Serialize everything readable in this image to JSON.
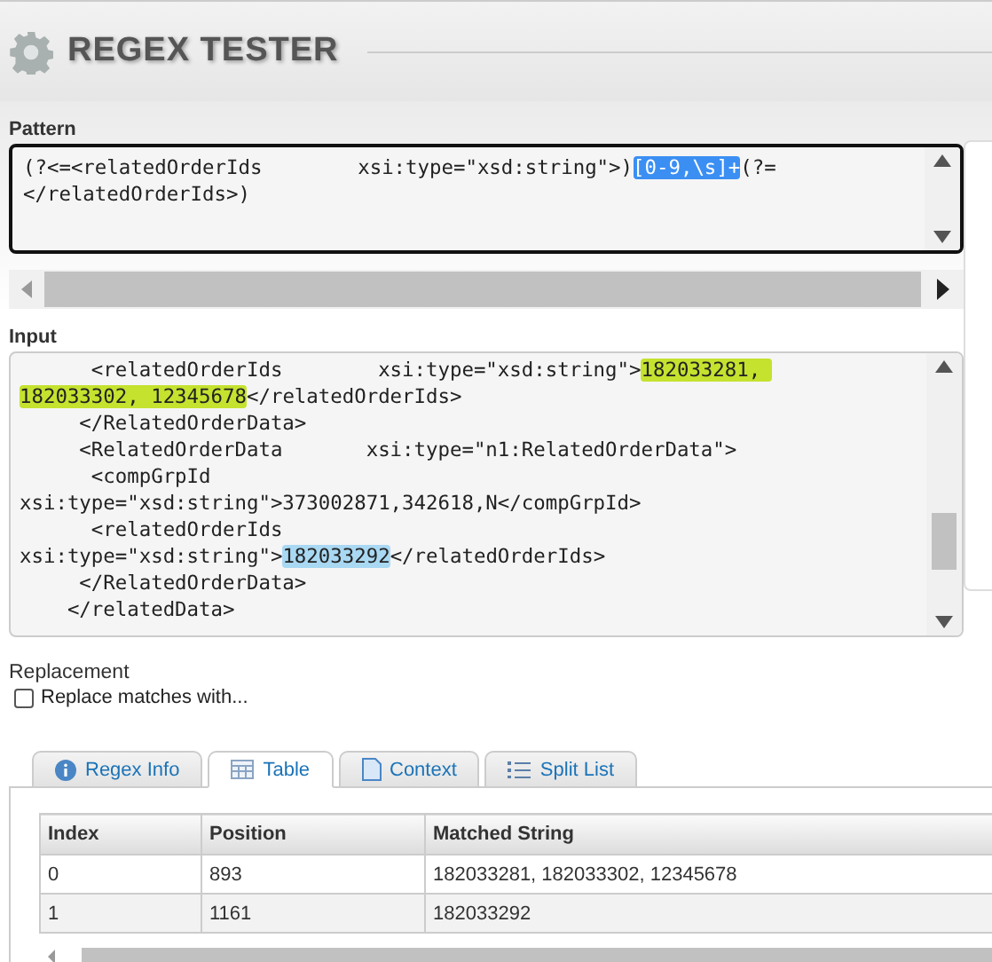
{
  "header": {
    "title": "REGEX TESTER"
  },
  "pattern": {
    "label": "Pattern",
    "lines": [
      [
        {
          "text": "(?<=<relatedOrderIds        xsi:type=\"xsd:string\">)",
          "selected": false
        },
        {
          "text": "[0-9,\\s]+",
          "selected": true
        },
        {
          "text": "(?=",
          "selected": false
        }
      ],
      [
        {
          "text": "</relatedOrderIds>)",
          "selected": false
        }
      ]
    ]
  },
  "input": {
    "label": "Input",
    "lines": [
      [
        {
          "text": "      <relatedOrderIds        xsi:type=\"xsd:string\">",
          "kind": "text"
        },
        {
          "text": "182033281, ",
          "kind": "match",
          "color": "#c5e22f"
        }
      ],
      [
        {
          "text": "182033302, 12345678",
          "kind": "match",
          "color": "#c5e22f"
        },
        {
          "text": "</relatedOrderIds>",
          "kind": "text"
        }
      ],
      [
        {
          "text": "     </RelatedOrderData>",
          "kind": "text"
        }
      ],
      [
        {
          "text": "     <RelatedOrderData       xsi:type=\"n1:RelatedOrderData\">",
          "kind": "text"
        }
      ],
      [
        {
          "text": "      <compGrpId",
          "kind": "text"
        }
      ],
      [
        {
          "text": "xsi:type=\"xsd:string\">373002871,342618,N</compGrpId>",
          "kind": "text"
        }
      ],
      [
        {
          "text": "      <relatedOrderIds",
          "kind": "text"
        }
      ],
      [
        {
          "text": "xsi:type=\"xsd:string\">",
          "kind": "text"
        },
        {
          "text": "182033292",
          "kind": "match",
          "color": "#a9d8f2"
        },
        {
          "text": "</relatedOrderIds>",
          "kind": "text"
        }
      ],
      [
        {
          "text": "     </RelatedOrderData>",
          "kind": "text"
        }
      ],
      [
        {
          "text": "    </relatedData>",
          "kind": "text"
        }
      ]
    ]
  },
  "replacement": {
    "label": "Replacement",
    "checkbox": {
      "label": "Replace matches with...",
      "checked": false
    }
  },
  "tabs": [
    {
      "label": "Regex Info",
      "kind": "info",
      "selected": false
    },
    {
      "label": "Table",
      "kind": "table",
      "selected": true
    },
    {
      "label": "Context",
      "kind": "page",
      "selected": false
    },
    {
      "label": "Split List",
      "kind": "list",
      "selected": false
    }
  ],
  "table": {
    "columns": [
      "Index",
      "Position",
      "Matched String"
    ],
    "rows": [
      [
        "0",
        "893",
        "182033281, 182033302, 12345678"
      ],
      [
        "1",
        "1161",
        "182033292"
      ]
    ]
  }
}
